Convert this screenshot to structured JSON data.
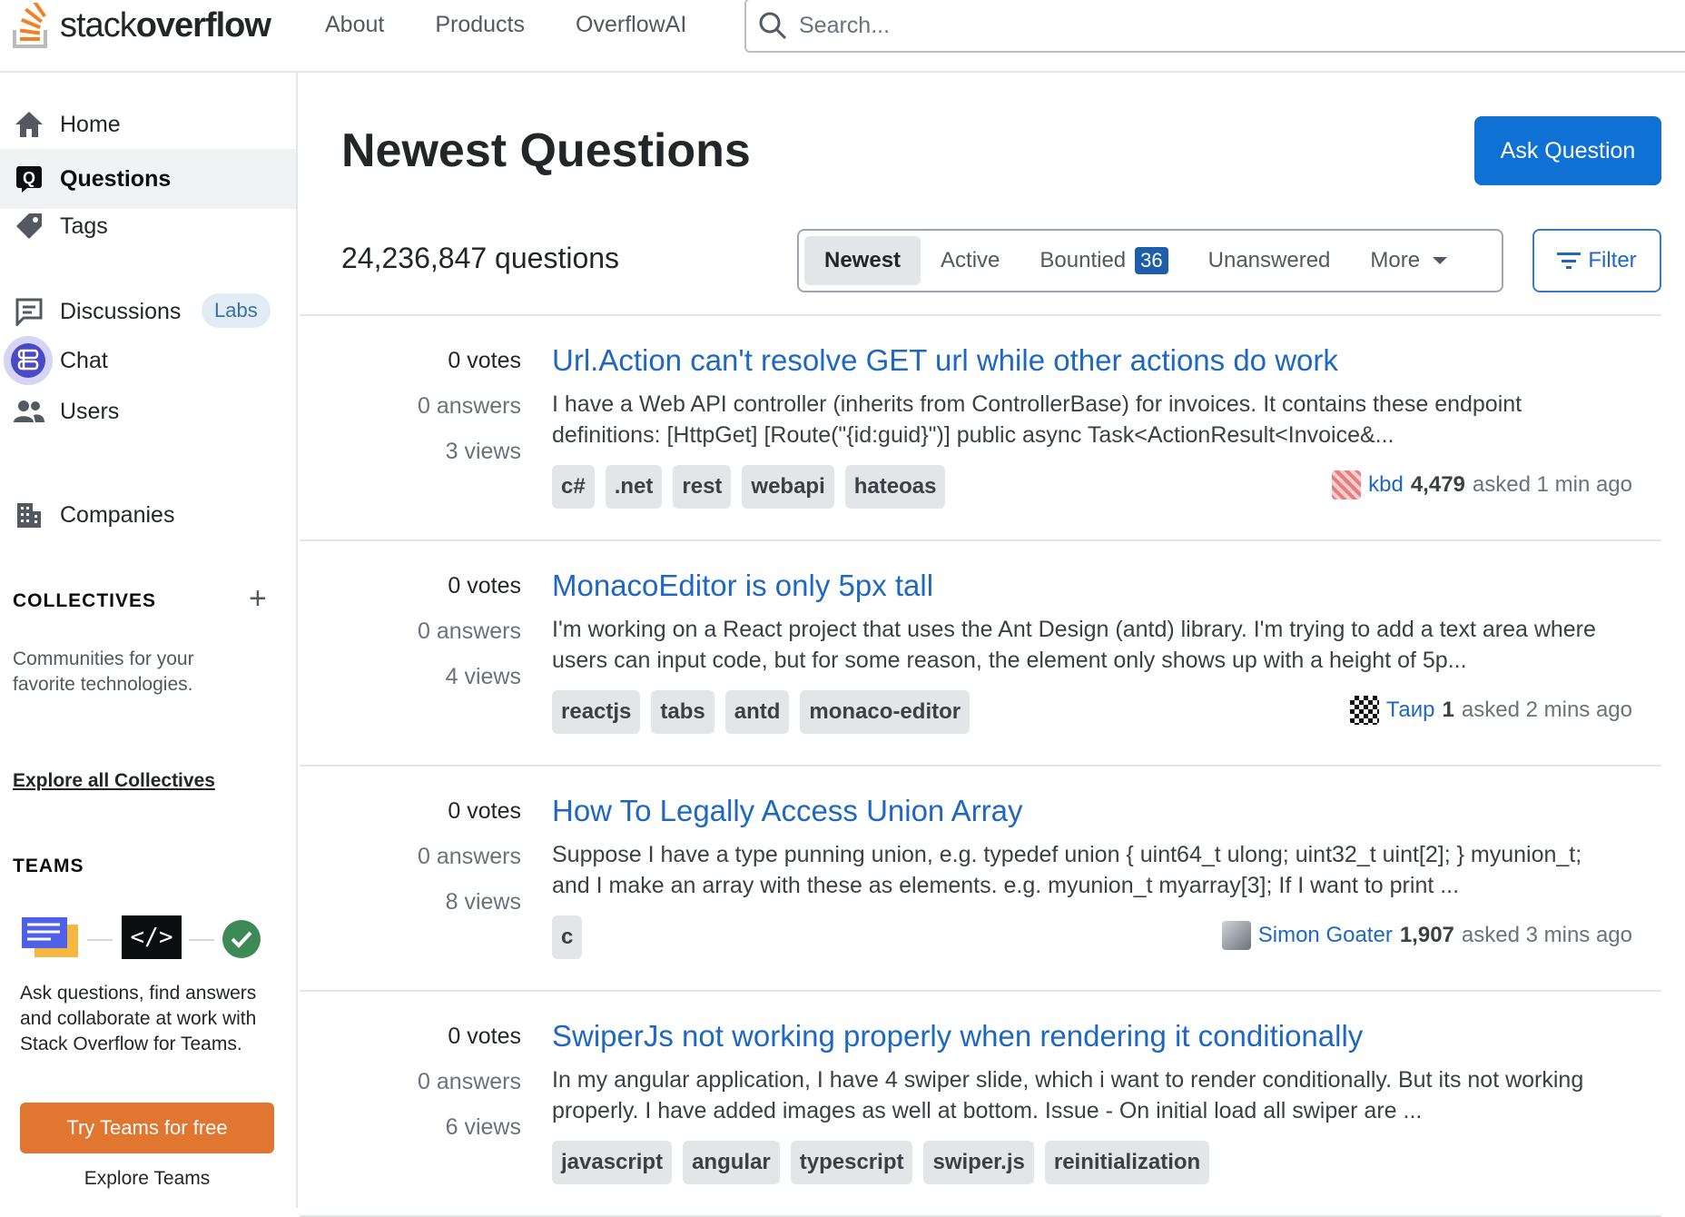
{
  "header": {
    "logo_light": "stack",
    "logo_bold": "overflow",
    "nav": [
      "About",
      "Products",
      "OverflowAI"
    ],
    "search_placeholder": "Search..."
  },
  "sidebar": {
    "items": [
      {
        "label": "Home"
      },
      {
        "label": "Questions"
      },
      {
        "label": "Tags"
      },
      {
        "label": "Discussions",
        "badge": "Labs"
      },
      {
        "label": "Chat"
      },
      {
        "label": "Users"
      },
      {
        "label": "Companies"
      }
    ],
    "collectives": {
      "title": "COLLECTIVES",
      "description": "Communities for your favorite technologies.",
      "link": "Explore all Collectives"
    },
    "teams": {
      "title": "TEAMS",
      "description": "Ask questions, find answers and collaborate at work with Stack Overflow for Teams.",
      "button": "Try Teams for free",
      "explore": "Explore Teams"
    }
  },
  "main": {
    "title": "Newest Questions",
    "ask_button": "Ask Question",
    "question_count": "24,236,847 questions",
    "tabs": {
      "newest": "Newest",
      "active": "Active",
      "bountied": "Bountied",
      "bountied_count": "36",
      "unanswered": "Unanswered",
      "more": "More"
    },
    "filter_button": "Filter",
    "questions": [
      {
        "votes": "0 votes",
        "answers": "0 answers",
        "views": "3 views",
        "title": "Url.Action can't resolve GET url while other actions do work",
        "excerpt": "I have a Web API controller (inherits from ControllerBase) for invoices. It contains these endpoint definitions: [HttpGet] [Route(\"{id:guid}\")] public async Task<ActionResult<Invoice&...",
        "tags": [
          "c#",
          ".net",
          "rest",
          "webapi",
          "hateoas"
        ],
        "user": "kbd",
        "rep": "4,479",
        "time": "asked 1 min ago"
      },
      {
        "votes": "0 votes",
        "answers": "0 answers",
        "views": "4 views",
        "title": "MonacoEditor is only 5px tall",
        "excerpt": "I'm working on a React project that uses the Ant Design (antd) library. I'm trying to add a text area where users can input code, but for some reason, the element only shows up with a height of 5p...",
        "tags": [
          "reactjs",
          "tabs",
          "antd",
          "monaco-editor"
        ],
        "user": "Таир",
        "rep": "1",
        "time": "asked 2 mins ago"
      },
      {
        "votes": "0 votes",
        "answers": "0 answers",
        "views": "8 views",
        "title": "How To Legally Access Union Array",
        "excerpt": "Suppose I have a type punning union, e.g. typedef union { uint64_t ulong; uint32_t uint[2]; } myunion_t; and I make an array with these as elements. e.g. myunion_t myarray[3]; If I want to print ...",
        "tags": [
          "c"
        ],
        "user": "Simon Goater",
        "rep": "1,907",
        "time": "asked 3 mins ago"
      },
      {
        "votes": "0 votes",
        "answers": "0 answers",
        "views": "6 views",
        "title": "SwiperJs not working properly when rendering it conditionally",
        "excerpt": "In my angular application, I have 4 swiper slide, which i want to render conditionally. But its not working properly. I have added images as well at bottom. Issue - On initial load all swiper are ...",
        "tags": [
          "javascript",
          "angular",
          "typescript",
          "swiper.js",
          "reinitialization"
        ],
        "user": "",
        "rep": "",
        "time": ""
      }
    ]
  },
  "colors": {
    "accent": "#1f68c2",
    "logo_orange": "#f48024",
    "teams_orange": "#e0762f",
    "ask_blue": "#0f71d3"
  }
}
